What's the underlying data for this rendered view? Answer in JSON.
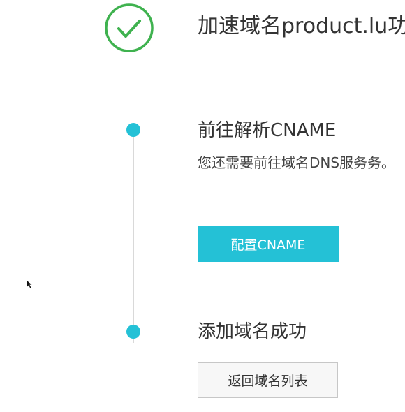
{
  "success": {
    "icon": "check-circle-icon",
    "title": "加速域名product.lu... 功！",
    "title_text": "加速域名product.lu功！"
  },
  "steps": [
    {
      "title": "前往解析CNAME",
      "description": "您还需要前往域名DNS服务务。",
      "button_label": "配置CNAME"
    },
    {
      "title": "添加域名成功",
      "button_label": "返回域名列表"
    }
  ],
  "colors": {
    "accent": "#24c1d6",
    "success": "#3fb24f",
    "timeline": "#d9d9d9"
  }
}
